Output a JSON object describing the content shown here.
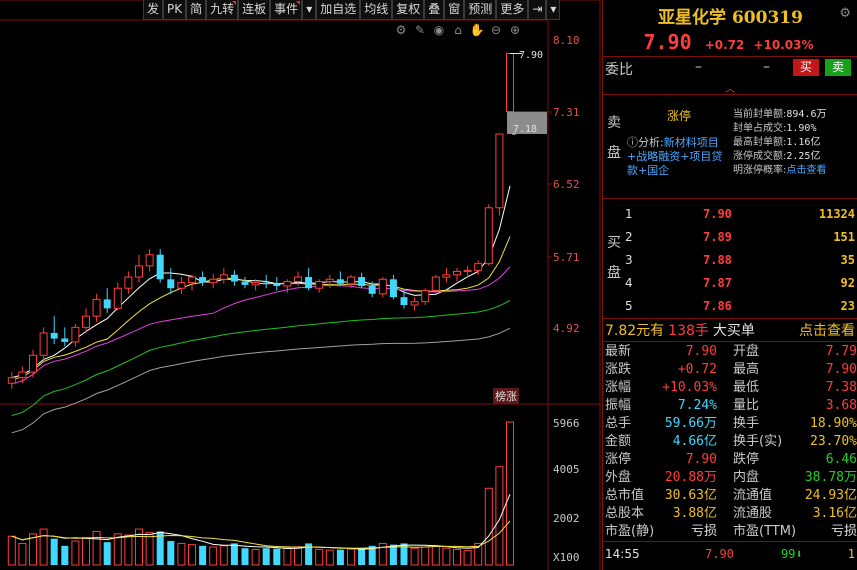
{
  "toolbar": {
    "buttons": [
      "发",
      "PK",
      "简",
      "九转",
      "连板",
      "事件",
      "▾",
      "加自选",
      "均线",
      "复权",
      "叠",
      "窗",
      "预测",
      "更多",
      "⇥",
      "▾"
    ]
  },
  "chart_tools": [
    "⚙",
    "✎",
    "◉",
    "⌂",
    "✋",
    "⊖",
    "⊕"
  ],
  "colors": {
    "up": "#ff3c3c",
    "down": "#40d8ff",
    "ma5": "#ffffff",
    "ma10": "#f0e040",
    "ma20": "#e040e0",
    "ma60": "#20c020",
    "ma120": "#a0a0a0"
  },
  "price_axis": {
    "ticks": [
      "8.10",
      "7.31",
      "6.52",
      "5.71",
      "4.92"
    ],
    "min": 4.8,
    "max": 8.2
  },
  "volume_axis": {
    "ticks": [
      "5966",
      "4005",
      "2002",
      "X100"
    ]
  },
  "chart_annotations": {
    "high_label": "7.90",
    "low_label": "7.18",
    "tag": "榜涨"
  },
  "chart_data": {
    "type": "candlestick",
    "unit_volume": "手 ×100",
    "candles": [
      {
        "o": 4.95,
        "h": 5.05,
        "l": 4.9,
        "c": 5.0,
        "v": 1200
      },
      {
        "o": 5.0,
        "h": 5.1,
        "l": 4.95,
        "c": 5.05,
        "v": 900
      },
      {
        "o": 5.05,
        "h": 5.25,
        "l": 5.0,
        "c": 5.2,
        "v": 1300
      },
      {
        "o": 5.2,
        "h": 5.45,
        "l": 5.15,
        "c": 5.4,
        "v": 1500
      },
      {
        "o": 5.4,
        "h": 5.55,
        "l": 5.3,
        "c": 5.35,
        "v": 1100
      },
      {
        "o": 5.35,
        "h": 5.45,
        "l": 5.28,
        "c": 5.32,
        "v": 800
      },
      {
        "o": 5.32,
        "h": 5.48,
        "l": 5.28,
        "c": 5.45,
        "v": 1000
      },
      {
        "o": 5.45,
        "h": 5.62,
        "l": 5.4,
        "c": 5.55,
        "v": 1150
      },
      {
        "o": 5.55,
        "h": 5.75,
        "l": 5.5,
        "c": 5.7,
        "v": 1400
      },
      {
        "o": 5.7,
        "h": 5.8,
        "l": 5.58,
        "c": 5.62,
        "v": 950
      },
      {
        "o": 5.62,
        "h": 5.85,
        "l": 5.6,
        "c": 5.8,
        "v": 1300
      },
      {
        "o": 5.8,
        "h": 5.95,
        "l": 5.75,
        "c": 5.9,
        "v": 1250
      },
      {
        "o": 5.9,
        "h": 6.1,
        "l": 5.85,
        "c": 6.0,
        "v": 1500
      },
      {
        "o": 6.0,
        "h": 6.15,
        "l": 5.95,
        "c": 6.1,
        "v": 1350
      },
      {
        "o": 6.1,
        "h": 6.15,
        "l": 5.85,
        "c": 5.88,
        "v": 1400
      },
      {
        "o": 5.88,
        "h": 5.98,
        "l": 5.75,
        "c": 5.8,
        "v": 1000
      },
      {
        "o": 5.8,
        "h": 5.9,
        "l": 5.75,
        "c": 5.85,
        "v": 900
      },
      {
        "o": 5.85,
        "h": 5.92,
        "l": 5.78,
        "c": 5.9,
        "v": 850
      },
      {
        "o": 5.9,
        "h": 5.95,
        "l": 5.82,
        "c": 5.85,
        "v": 800
      },
      {
        "o": 5.85,
        "h": 5.93,
        "l": 5.8,
        "c": 5.88,
        "v": 750
      },
      {
        "o": 5.88,
        "h": 5.98,
        "l": 5.84,
        "c": 5.92,
        "v": 800
      },
      {
        "o": 5.92,
        "h": 5.96,
        "l": 5.82,
        "c": 5.86,
        "v": 900
      },
      {
        "o": 5.86,
        "h": 5.9,
        "l": 5.8,
        "c": 5.83,
        "v": 700
      },
      {
        "o": 5.83,
        "h": 5.88,
        "l": 5.78,
        "c": 5.85,
        "v": 650
      },
      {
        "o": 5.85,
        "h": 5.92,
        "l": 5.8,
        "c": 5.84,
        "v": 700
      },
      {
        "o": 5.84,
        "h": 5.9,
        "l": 5.78,
        "c": 5.82,
        "v": 680
      },
      {
        "o": 5.82,
        "h": 5.88,
        "l": 5.76,
        "c": 5.86,
        "v": 720
      },
      {
        "o": 5.86,
        "h": 5.95,
        "l": 5.82,
        "c": 5.9,
        "v": 760
      },
      {
        "o": 5.9,
        "h": 5.98,
        "l": 5.78,
        "c": 5.8,
        "v": 900
      },
      {
        "o": 5.8,
        "h": 5.88,
        "l": 5.76,
        "c": 5.86,
        "v": 650
      },
      {
        "o": 5.86,
        "h": 5.92,
        "l": 5.8,
        "c": 5.88,
        "v": 620
      },
      {
        "o": 5.88,
        "h": 5.95,
        "l": 5.82,
        "c": 5.84,
        "v": 640
      },
      {
        "o": 5.84,
        "h": 5.92,
        "l": 5.8,
        "c": 5.9,
        "v": 660
      },
      {
        "o": 5.9,
        "h": 5.94,
        "l": 5.8,
        "c": 5.82,
        "v": 700
      },
      {
        "o": 5.82,
        "h": 5.86,
        "l": 5.72,
        "c": 5.75,
        "v": 800
      },
      {
        "o": 5.75,
        "h": 5.9,
        "l": 5.72,
        "c": 5.88,
        "v": 900
      },
      {
        "o": 5.88,
        "h": 5.92,
        "l": 5.7,
        "c": 5.72,
        "v": 850
      },
      {
        "o": 5.72,
        "h": 5.78,
        "l": 5.62,
        "c": 5.65,
        "v": 900
      },
      {
        "o": 5.65,
        "h": 5.72,
        "l": 5.6,
        "c": 5.68,
        "v": 700
      },
      {
        "o": 5.68,
        "h": 5.8,
        "l": 5.65,
        "c": 5.78,
        "v": 750
      },
      {
        "o": 5.78,
        "h": 5.92,
        "l": 5.75,
        "c": 5.9,
        "v": 800
      },
      {
        "o": 5.9,
        "h": 5.98,
        "l": 5.85,
        "c": 5.92,
        "v": 700
      },
      {
        "o": 5.92,
        "h": 5.98,
        "l": 5.86,
        "c": 5.95,
        "v": 650
      },
      {
        "o": 5.95,
        "h": 6.0,
        "l": 5.9,
        "c": 5.96,
        "v": 600
      },
      {
        "o": 5.96,
        "h": 6.05,
        "l": 5.92,
        "c": 6.02,
        "v": 900
      },
      {
        "o": 6.02,
        "h": 6.55,
        "l": 6.0,
        "c": 6.52,
        "v": 3200
      },
      {
        "o": 6.52,
        "h": 7.18,
        "l": 6.45,
        "c": 7.18,
        "v": 4100
      },
      {
        "o": 7.38,
        "h": 7.9,
        "l": 7.38,
        "c": 7.9,
        "v": 5966
      }
    ],
    "ma_lines": [
      "MA5",
      "MA10",
      "MA20",
      "MA60",
      "MA120"
    ]
  },
  "quote": {
    "name": "亚星化学",
    "code": "600319",
    "price": "7.90",
    "change": "+0.72",
    "change_pct": "+10.03%",
    "weibi_label": "委比",
    "weibi_val1": "–",
    "weibi_val2": "–",
    "buy_btn": "买",
    "sell_btn": "卖",
    "sell_side_label": "卖盘",
    "buy_side_label": "买盘",
    "limit_up": {
      "title": "涨停",
      "analysis_prefix": "分析:",
      "analysis_text": "新材料项目+战略融资+项目贷款+国企",
      "stats": [
        {
          "k": "当前封单额:",
          "v": "894.6万"
        },
        {
          "k": "封单占成交:",
          "v": "1.90%"
        },
        {
          "k": "最高封单额:",
          "v": "1.16亿"
        },
        {
          "k": "涨停成交额:",
          "v": "2.25亿"
        },
        {
          "k": "明涨停概率:",
          "v": "点击查看"
        }
      ]
    },
    "bids": [
      {
        "level": "1",
        "price": "7.90",
        "qty": "11324"
      },
      {
        "level": "2",
        "price": "7.89",
        "qty": "151"
      },
      {
        "level": "3",
        "price": "7.88",
        "qty": "35"
      },
      {
        "level": "4",
        "price": "7.87",
        "qty": "92"
      },
      {
        "level": "5",
        "price": "7.86",
        "qty": "23"
      }
    ],
    "big_order": {
      "price": "7.82元有",
      "qty": "138手",
      "text": "大买单",
      "link": "点击查看"
    },
    "stats": [
      {
        "k1": "最新",
        "v1": "7.90",
        "c1": "red",
        "k2": "开盘",
        "v2": "7.79",
        "c2": "red"
      },
      {
        "k1": "涨跌",
        "v1": "+0.72",
        "c1": "red",
        "k2": "最高",
        "v2": "7.90",
        "c2": "red"
      },
      {
        "k1": "涨幅",
        "v1": "+10.03%",
        "c1": "red",
        "k2": "最低",
        "v2": "7.38",
        "c2": "red"
      },
      {
        "k1": "振幅",
        "v1": "7.24%",
        "c1": "cyn",
        "k2": "量比",
        "v2": "3.68",
        "c2": "red"
      },
      {
        "k1": "总手",
        "v1": "59.66万",
        "c1": "cyn",
        "k2": "换手",
        "v2": "18.90%",
        "c2": "yel"
      },
      {
        "k1": "金额",
        "v1": "4.66亿",
        "c1": "cyn",
        "k2": "换手(实)",
        "v2": "23.70%",
        "c2": "yel"
      },
      {
        "k1": "涨停",
        "v1": "7.90",
        "c1": "red",
        "k2": "跌停",
        "v2": "6.46",
        "c2": "grn"
      },
      {
        "k1": "外盘",
        "v1": "20.88万",
        "c1": "red",
        "k2": "内盘",
        "v2": "38.78万",
        "c2": "grn"
      },
      {
        "k1": "总市值",
        "v1": "30.63亿",
        "c1": "yel",
        "k2": "流通值",
        "v2": "24.93亿",
        "c2": "yel"
      },
      {
        "k1": "总股本",
        "v1": "3.88亿",
        "c1": "yel",
        "k2": "流通股",
        "v2": "3.16亿",
        "c2": "yel"
      },
      {
        "k1": "市盈(静)",
        "v1": "亏损",
        "c1": "wht",
        "k2": "市盈(TTM)",
        "v2": "亏损",
        "c2": "wht"
      }
    ],
    "last_tick": {
      "time": "14:55",
      "price": "7.90",
      "vol": "99",
      "dir": "⬇",
      "count": "1"
    }
  }
}
